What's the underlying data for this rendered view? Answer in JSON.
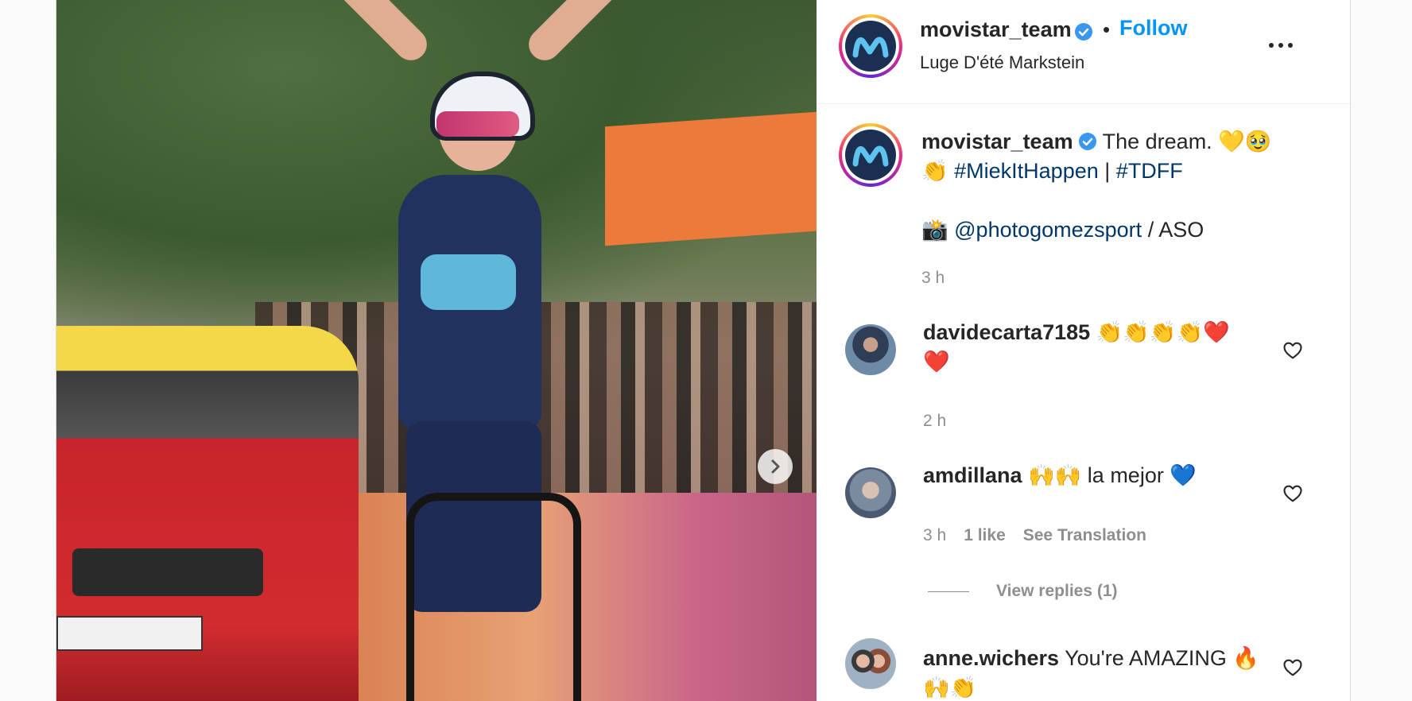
{
  "post": {
    "image_alt": "Cyclist celebrating with raised arms at the finish line",
    "next_icon": "chevron-right-icon"
  },
  "header": {
    "username": "movistar_team",
    "separator": "•",
    "follow_label": "Follow",
    "location": "Luge D'été Markstein",
    "more_icon": "more-horizontal-icon"
  },
  "caption": {
    "username": "movistar_team",
    "text_1": "The dream.",
    "emoji_1": "💛🥹",
    "emoji_2": "👏",
    "hashtag_1": "#MiekItHappen",
    "divider": "|",
    "hashtag_2": "#TDFF",
    "camera_emoji": "📸",
    "mention": "@photogomezsport",
    "credit": "/ ASO",
    "time": "3 h"
  },
  "comments": [
    {
      "username": "davidecarta7185",
      "text": "👏👏👏👏❤️",
      "text_2": "❤️",
      "time": "2 h"
    },
    {
      "username": "amdillana",
      "text": "🙌🙌 la mejor 💙",
      "time": "3 h",
      "likes": "1 like",
      "translation": "See Translation",
      "view_replies": "View replies (1)"
    },
    {
      "username": "anne.wichers",
      "text": "You're AMAZING 🔥",
      "text_2": "🙌👏"
    }
  ],
  "colors": {
    "link_blue": "#0095f6",
    "hashtag": "#00376b",
    "muted": "#8e8e8e",
    "text": "#262626",
    "verified": "#3897f0"
  }
}
